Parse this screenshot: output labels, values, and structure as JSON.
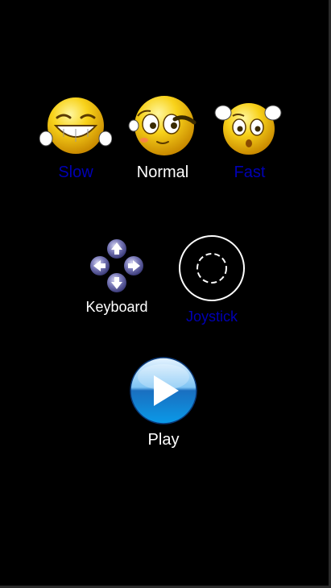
{
  "speed": {
    "options": [
      {
        "label": "Slow",
        "selected": false
      },
      {
        "label": "Normal",
        "selected": true
      },
      {
        "label": "Fast",
        "selected": false
      }
    ]
  },
  "control": {
    "options": [
      {
        "label": "Keyboard",
        "selected": true
      },
      {
        "label": "Joystick",
        "selected": false
      }
    ]
  },
  "play": {
    "label": "Play"
  },
  "colors": {
    "background": "#000000",
    "selected_label": "#ffffff",
    "unselected_label": "#0000b4",
    "emoji_yellow": "#f5c400",
    "dpad": "#5a5a9c",
    "play_blue": "#1a7fd0"
  },
  "icons": {
    "slow": "laughing-face-icon",
    "normal": "winking-face-icon",
    "fast": "worried-face-icon",
    "keyboard": "arrow-keys-icon",
    "joystick": "joystick-circle-icon",
    "play": "play-triangle-icon"
  }
}
